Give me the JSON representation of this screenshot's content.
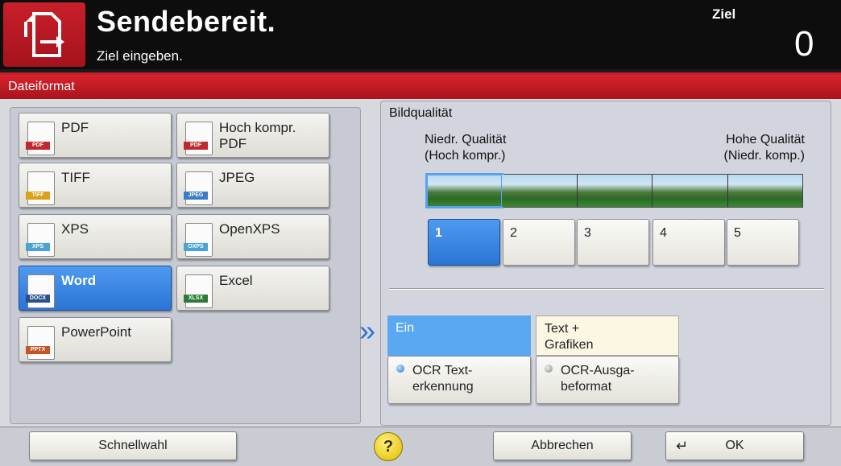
{
  "header": {
    "title": "Sendebereit.",
    "subtitle": "Ziel eingeben.",
    "ziel_label": "Ziel",
    "ziel_count": "0"
  },
  "section": {
    "title": "Dateiformat"
  },
  "formats": [
    {
      "label": "PDF",
      "tag": "PDF",
      "selected": false
    },
    {
      "label": "Hoch kompr.\nPDF",
      "tag": "PDF",
      "selected": false
    },
    {
      "label": "TIFF",
      "tag": "TIFF",
      "selected": false
    },
    {
      "label": "JPEG",
      "tag": "JPEG",
      "selected": false
    },
    {
      "label": "XPS",
      "tag": "XPS",
      "selected": false
    },
    {
      "label": "OpenXPS",
      "tag": "OXPS",
      "selected": false
    },
    {
      "label": "Word",
      "tag": "DOCX",
      "selected": true
    },
    {
      "label": "Excel",
      "tag": "XLSX",
      "selected": false
    },
    {
      "label": "PowerPoint",
      "tag": "PPTX",
      "selected": false
    }
  ],
  "quality": {
    "title": "Bildqualität",
    "low_label_1": "Niedr. Qualität",
    "low_label_2": "(Hoch kompr.)",
    "high_label_1": "Hohe Qualität",
    "high_label_2": "(Niedr. komp.)",
    "levels": [
      "1",
      "2",
      "3",
      "4",
      "5"
    ],
    "selected_level": "1"
  },
  "ocr": {
    "on_label": "Ein",
    "text_graphics_label_1": "Text +",
    "text_graphics_label_2": "Grafiken",
    "ocr_text_1": "OCR Text-",
    "ocr_text_2": "erkennung",
    "ocr_output_1": "OCR-Ausga-",
    "ocr_output_2": "beformat"
  },
  "footer": {
    "quick": "Schnellwahl",
    "help": "?",
    "cancel": "Abbrechen",
    "ok": "OK"
  },
  "colors": {
    "accent_red": "#c41e28",
    "selected_blue": "#2a74d6"
  }
}
